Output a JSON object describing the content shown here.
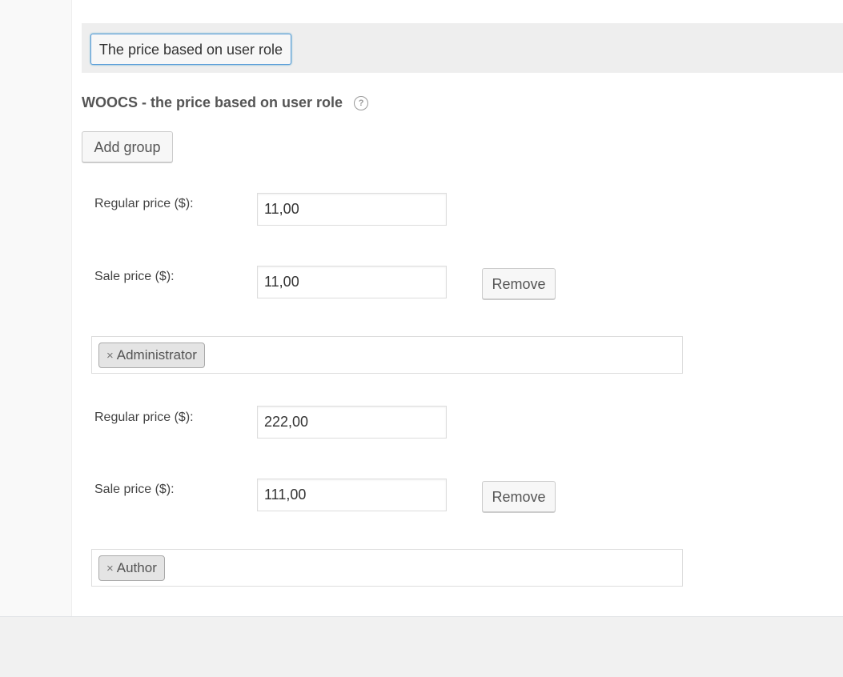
{
  "tab": {
    "label": "The price based on user role"
  },
  "section": {
    "title": "WOOCS - the price based on user role",
    "help_icon": "question-circle-icon"
  },
  "add_group_label": "Add group",
  "groups": [
    {
      "regular_label": "Regular price ($):",
      "regular_value": "11,00",
      "sale_label": "Sale price ($):",
      "sale_value": "11,00",
      "remove_label": "Remove",
      "role_remove": "×",
      "role": "Administrator"
    },
    {
      "regular_label": "Regular price ($):",
      "regular_value": "222,00",
      "sale_label": "Sale price ($):",
      "sale_value": "111,00",
      "remove_label": "Remove",
      "role_remove": "×",
      "role": "Author"
    }
  ]
}
